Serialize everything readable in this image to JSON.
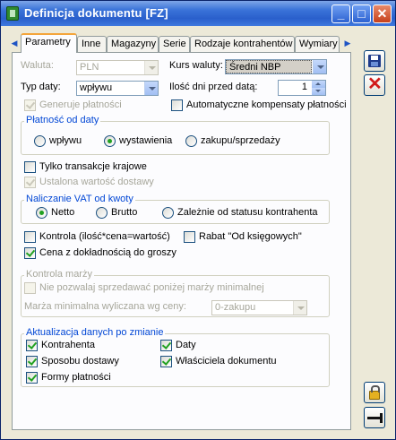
{
  "window": {
    "title": "Definicja dokumentu [FZ]",
    "controls": {
      "minimize": "_",
      "maximize": "□",
      "close": "✕"
    }
  },
  "tabs": {
    "items": [
      "Parametry",
      "Inne",
      "Magazyny",
      "Serie",
      "Rodzaje kontrahentów",
      "Wymiary"
    ],
    "active": "Parametry"
  },
  "form": {
    "waluta": {
      "label": "Waluta:",
      "value": "PLN"
    },
    "kurs": {
      "label": "Kurs waluty:",
      "value": "Średni NBP"
    },
    "typ_daty": {
      "label": "Typ daty:",
      "value": "wpływu"
    },
    "ilosc_dni": {
      "label": "Ilość dni przed datą:",
      "value": "1"
    },
    "generuje": {
      "label": "Generuje płatności",
      "checked": true,
      "enabled": false
    },
    "auto_kompensaty": {
      "label": "Automatyczne kompensaty płatności",
      "checked": false
    }
  },
  "platnosc": {
    "title": "Płatność od daty",
    "options": [
      "wpływu",
      "wystawienia",
      "zakupu/sprzedaży"
    ],
    "selected": "wystawienia"
  },
  "transakcje": {
    "krajowe": {
      "label": "Tylko transakcje krajowe",
      "checked": false
    },
    "ustalona": {
      "label": "Ustalona wartość dostawy",
      "checked": true,
      "enabled": false
    }
  },
  "vat": {
    "title": "Naliczanie VAT od kwoty",
    "options": [
      "Netto",
      "Brutto",
      "Zależnie od statusu kontrahenta"
    ],
    "selected": "Netto"
  },
  "kontrola": {
    "kontrola_ilosc": {
      "label": "Kontrola (ilość*cena=wartość)",
      "checked": false
    },
    "rabat": {
      "label": "Rabat \"Od księgowych\"",
      "checked": false
    },
    "cena_dokladnosc": {
      "label": "Cena z dokładnością do groszy",
      "checked": true
    }
  },
  "marza": {
    "title": "Kontrola marży",
    "nie_pozwalaj": {
      "label": "Nie pozwalaj sprzedawać poniżej marży minimalnej",
      "checked": false
    },
    "wyliczana": {
      "label": "Marża minimalna wyliczana wg ceny:",
      "value": "0-zakupu"
    }
  },
  "aktualizacja": {
    "title": "Aktualizacja danych po zmianie",
    "kontrahenta": {
      "label": "Kontrahenta",
      "checked": true
    },
    "daty": {
      "label": "Daty",
      "checked": true
    },
    "sposobu": {
      "label": "Sposobu dostawy",
      "checked": true
    },
    "wlasciciela": {
      "label": "Właściciela dokumentu",
      "checked": true
    },
    "formy": {
      "label": "Formy płatności",
      "checked": true
    }
  },
  "side": {
    "save_icon": "floppy-disk-icon",
    "cancel_icon": "red-x-icon",
    "lock_icon": "padlock-icon",
    "pin_icon": "pin-icon"
  },
  "colors": {
    "titlebar": "#2a5fcc",
    "group_title": "#0046d5",
    "check": "#21a121",
    "tab_accent": "#f4a53b"
  }
}
